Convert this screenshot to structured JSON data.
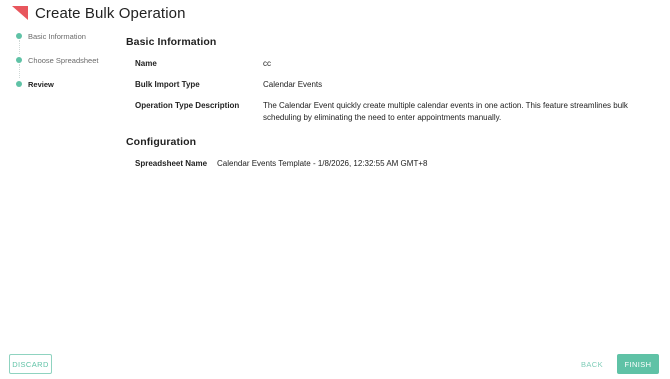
{
  "header": {
    "title": "Create Bulk Operation"
  },
  "stepper": {
    "steps": [
      {
        "label": "Basic Information",
        "state": "done"
      },
      {
        "label": "Choose Spreadsheet",
        "state": "done"
      },
      {
        "label": "Review",
        "state": "active"
      }
    ]
  },
  "basic_info": {
    "title": "Basic Information",
    "name_label": "Name",
    "name_value": "cc",
    "type_label": "Bulk Import Type",
    "type_value": "Calendar Events",
    "desc_label": "Operation Type Description",
    "desc_value": "The Calendar Event quickly create multiple calendar events in one action. This feature streamlines bulk scheduling by eliminating the need to enter appointments manually."
  },
  "configuration": {
    "title": "Configuration",
    "sheet_label": "Spreadsheet Name",
    "sheet_value": "Calendar Events Template - 1/8/2026, 12:32:55 AM GMT+8"
  },
  "footer": {
    "discard_label": "DISCARD",
    "back_label": "BACK",
    "finish_label": "FINISH"
  },
  "colors": {
    "accent": "#5fc2a6",
    "logo": "#e8565d"
  },
  "icons": {
    "logo": "triangle-logo-icon",
    "step_dot": "step-dot-icon"
  }
}
